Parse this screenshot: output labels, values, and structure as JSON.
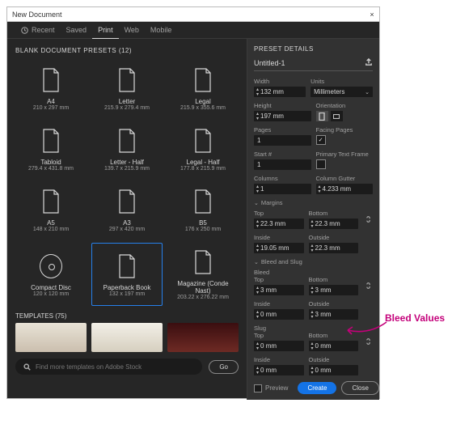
{
  "title": "New Document",
  "tabs": {
    "recent": "Recent",
    "saved": "Saved",
    "print": "Print",
    "web": "Web",
    "mobile": "Mobile"
  },
  "section_presets": "BLANK DOCUMENT PRESETS  (12)",
  "presets": [
    {
      "name": "A4",
      "dim": "210 x 297 mm"
    },
    {
      "name": "Letter",
      "dim": "215.9 x 279.4 mm"
    },
    {
      "name": "Legal",
      "dim": "215.9 x 355.6 mm"
    },
    {
      "name": "Tabloid",
      "dim": "279.4 x 431.8 mm"
    },
    {
      "name": "Letter - Half",
      "dim": "139.7 x 215.9 mm"
    },
    {
      "name": "Legal - Half",
      "dim": "177.8 x 215.9 mm"
    },
    {
      "name": "A5",
      "dim": "148 x 210 mm"
    },
    {
      "name": "A3",
      "dim": "297 x 420 mm"
    },
    {
      "name": "B5",
      "dim": "176 x 250 mm"
    },
    {
      "name": "Compact Disc",
      "dim": "120 x 120 mm"
    },
    {
      "name": "Paperback Book",
      "dim": "132 x 197 mm"
    },
    {
      "name": "Magazine (Conde Nast)",
      "dim": "203.22 x 276.22 mm"
    }
  ],
  "selected_preset_index": 10,
  "templates_header": "TEMPLATES  (75)",
  "search_placeholder": "Find more templates on Adobe Stock",
  "go": "Go",
  "details": {
    "header": "PRESET DETAILS",
    "name": "Untitled-1",
    "width_l": "Width",
    "width": "132 mm",
    "units_l": "Units",
    "units": "Millimeters",
    "height_l": "Height",
    "height": "197 mm",
    "orientation_l": "Orientation",
    "pages_l": "Pages",
    "pages": "1",
    "facing_l": "Facing Pages",
    "facing_checked": true,
    "start_l": "Start #",
    "start": "1",
    "ptf_l": "Primary Text Frame",
    "ptf_checked": false,
    "columns_l": "Columns",
    "columns": "1",
    "gutter_l": "Column Gutter",
    "gutter": "4.233 mm",
    "margins_l": "Margins",
    "m_top_l": "Top",
    "m_top": "22.3 mm",
    "m_bot_l": "Bottom",
    "m_bot": "22.3 mm",
    "m_in_l": "Inside",
    "m_in": "19.05 mm",
    "m_out_l": "Outside",
    "m_out": "22.3 mm",
    "bleedslug_l": "Bleed and Slug",
    "bleed_l": "Bleed",
    "b_top_l": "Top",
    "b_top": "3 mm",
    "b_bot_l": "Bottom",
    "b_bot": "3 mm",
    "b_in_l": "Inside",
    "b_in": "0 mm",
    "b_out_l": "Outside",
    "b_out": "3 mm",
    "slug_l": "Slug",
    "s_top_l": "Top",
    "s_top": "0 mm",
    "s_bot_l": "Bottom",
    "s_bot": "0 mm",
    "s_in_l": "Inside",
    "s_in": "0 mm",
    "s_out_l": "Outside",
    "s_out": "0 mm"
  },
  "footer": {
    "preview": "Preview",
    "create": "Create",
    "close": "Close"
  },
  "annotation": "Bleed Values"
}
